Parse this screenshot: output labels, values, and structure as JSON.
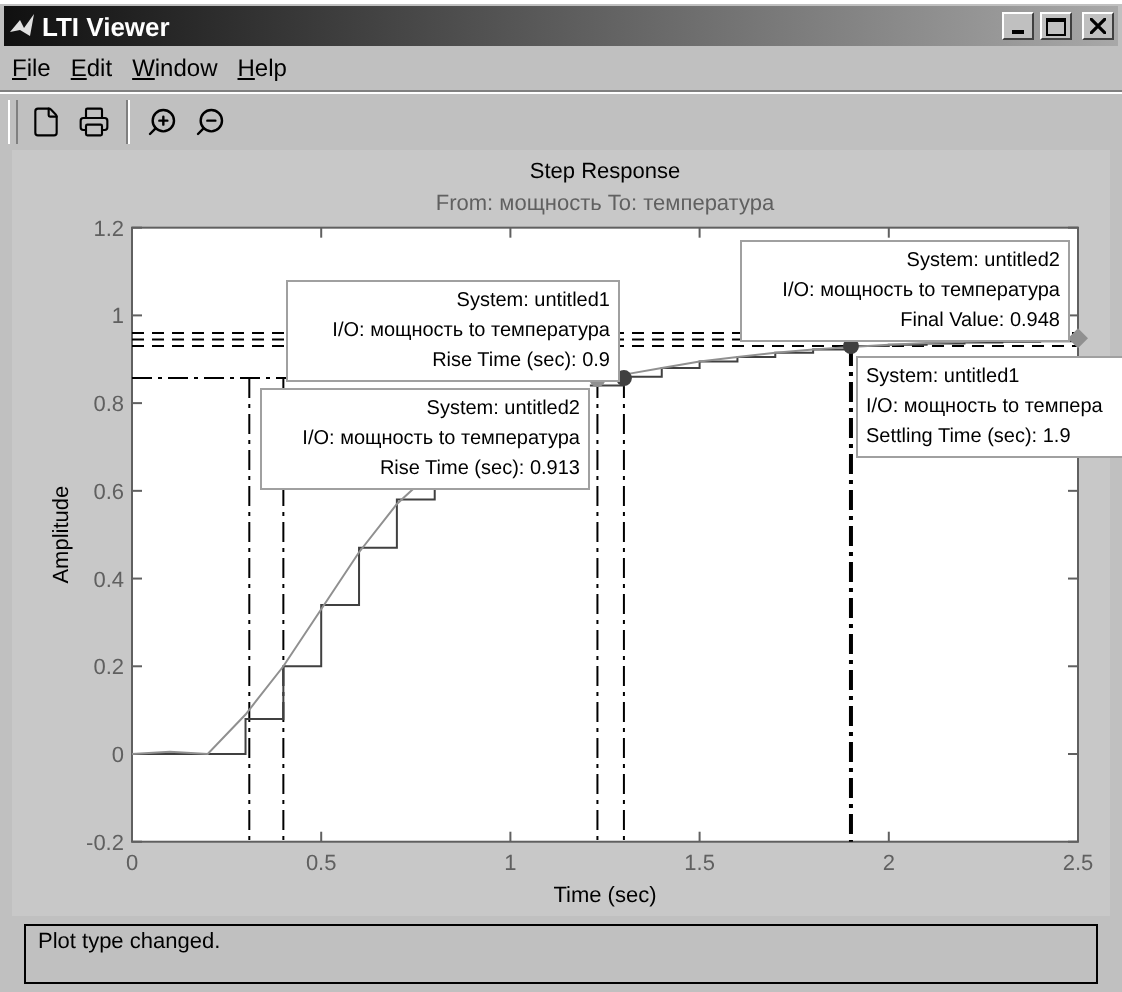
{
  "window": {
    "title": "LTI Viewer"
  },
  "menu": [
    {
      "label": "File"
    },
    {
      "label": "Edit"
    },
    {
      "label": "Window"
    },
    {
      "label": "Help"
    }
  ],
  "plot": {
    "subtitle": "From: мощность  To: температура",
    "chart_data": {
      "type": "line",
      "title": "Step Response",
      "xlabel": "Time (sec)",
      "ylabel": "Amplitude",
      "x": [
        0,
        0.1,
        0.1,
        0.2,
        0.2,
        0.3,
        0.3,
        0.4,
        0.4,
        0.5,
        0.5,
        0.6,
        0.6,
        0.7,
        0.7,
        0.75,
        0.8,
        0.8,
        1.0,
        1.21,
        1.3,
        1.3,
        1.4,
        1.4,
        1.5,
        1.5,
        1.6,
        1.6,
        1.7,
        1.7,
        1.8,
        1.8,
        1.9,
        1.9,
        2.0,
        2.0,
        2.1,
        2.1,
        2.2,
        2.2,
        2.3,
        2.3,
        2.4,
        2.4,
        2.5,
        2.5
      ],
      "series": [
        {
          "color": "#404040",
          "values": [
            0,
            0,
            0,
            0,
            0,
            0,
            0.08,
            0.08,
            0.2,
            0.2,
            0.34,
            0.34,
            0.47,
            0.47,
            0.58,
            0.58,
            0.58,
            0.61,
            null,
            0.84,
            0.84,
            0.86,
            0.86,
            0.88,
            0.88,
            0.895,
            0.895,
            0.905,
            0.905,
            0.915,
            0.915,
            0.922,
            0.922,
            0.93,
            0.93,
            0.933,
            0.933,
            0.936,
            0.936,
            0.938,
            0.938,
            0.94,
            0.94,
            0.941,
            0.941,
            0.942
          ]
        },
        {
          "color": "#909090",
          "values": [
            0,
            0.005,
            0.005,
            0,
            0,
            0.09,
            0.09,
            0.2,
            0.2,
            0.33,
            0.33,
            0.46,
            0.46,
            0.57,
            0.57,
            0.61,
            null,
            null,
            null,
            0.855,
            0.865,
            0.865,
            0.88,
            0.88,
            0.895,
            0.895,
            0.905,
            0.905,
            0.915,
            0.915,
            0.922,
            0.922,
            0.928,
            0.928,
            0.933,
            0.933,
            0.937,
            0.937,
            0.94,
            0.94,
            0.943,
            0.943,
            0.946,
            0.946,
            0.948,
            0.948
          ]
        }
      ],
      "xlim": [
        0,
        2.5
      ],
      "ylim": [
        -0.2,
        1.2
      ],
      "xticks": [
        0,
        0.5,
        1,
        1.5,
        2,
        2.5
      ],
      "yticks": [
        -0.2,
        0,
        0.2,
        0.4,
        0.6,
        0.8,
        1,
        1.2
      ],
      "ref_lines": [
        {
          "axis": "y",
          "value": 0.96
        },
        {
          "axis": "y",
          "value": 0.945
        },
        {
          "axis": "y",
          "value": 0.93
        },
        {
          "axis": "y",
          "value": 0.857
        },
        {
          "axis": "x",
          "value": 0.31
        },
        {
          "axis": "x",
          "value": 0.4
        },
        {
          "axis": "x",
          "value": 1.23
        },
        {
          "axis": "x",
          "value": 1.3
        },
        {
          "axis": "x",
          "value": 1.9
        }
      ]
    },
    "datatips": [
      {
        "lines": [
          "System: untitled1",
          "I/O: мощность to температура",
          "Rise Time (sec): 0.9"
        ]
      },
      {
        "lines": [
          "System: untitled2",
          "I/O: мощность to температура",
          "Rise Time (sec): 0.913"
        ]
      },
      {
        "lines": [
          "System: untitled2",
          "I/O: мощность to температура",
          "Final Value: 0.948"
        ]
      },
      {
        "lines": [
          "System: untitled1",
          "I/O: мощность to темпера",
          "Settling Time (sec): 1.9"
        ]
      }
    ]
  },
  "status_bar": {
    "text": "Plot type changed."
  }
}
